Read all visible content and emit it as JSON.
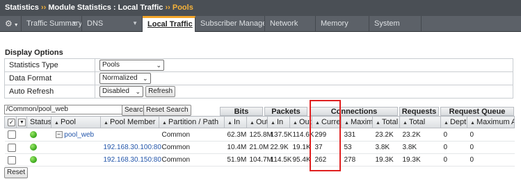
{
  "breadcrumb": {
    "items": [
      "Statistics",
      "Module Statistics : Local Traffic",
      "Pools"
    ],
    "separator": "››"
  },
  "tabs": [
    {
      "label": "Traffic Summary",
      "has_dropdown": true,
      "active": false
    },
    {
      "label": "DNS",
      "has_dropdown": true,
      "active": false
    },
    {
      "label": "Local Traffic",
      "has_dropdown": false,
      "active": true
    },
    {
      "label": "Subscriber Management",
      "has_dropdown": false,
      "active": false
    },
    {
      "label": "Network",
      "has_dropdown": false,
      "active": false
    },
    {
      "label": "Memory",
      "has_dropdown": false,
      "active": false
    },
    {
      "label": "System",
      "has_dropdown": false,
      "active": false
    }
  ],
  "gear_icon": "gear-icon",
  "display_options": {
    "title": "Display Options",
    "statistics_type": {
      "label": "Statistics Type",
      "value": "Pools"
    },
    "data_format": {
      "label": "Data Format",
      "value": "Normalized"
    },
    "auto_refresh": {
      "label": "Auto Refresh",
      "value": "Disabled",
      "refresh_button": "Refresh"
    }
  },
  "search": {
    "value": "/Common/pool_web",
    "search_button": "Search",
    "reset_search_button": "Reset Search"
  },
  "column_groups": {
    "bits": "Bits",
    "packets": "Packets",
    "connections": "Connections",
    "requests": "Requests",
    "request_queue": "Request Queue"
  },
  "columns": {
    "status": "Status",
    "pool": "Pool",
    "pool_member": "Pool Member",
    "partition": "Partition / Path",
    "bits_in": "In",
    "bits_out": "Out",
    "packets_in": "In",
    "packets_out": "Out",
    "current": "Current",
    "maximum": "Maximum",
    "total": "Total",
    "requests_total": "Total",
    "depth": "Depth",
    "maximum_age": "Maximum Age"
  },
  "rows": [
    {
      "pool": "pool_web",
      "pool_member": "",
      "partition": "Common",
      "bits_in": "62.3M",
      "bits_out": "125.8M",
      "packets_in": "137.5K",
      "packets_out": "114.6K",
      "current": "299",
      "maximum": "331",
      "total": "23.2K",
      "requests_total": "23.2K",
      "depth": "0",
      "maximum_age": "0"
    },
    {
      "pool": "",
      "pool_member": "192.168.30.100:80",
      "partition": "Common",
      "bits_in": "10.4M",
      "bits_out": "21.0M",
      "packets_in": "22.9K",
      "packets_out": "19.1K",
      "current": "37",
      "maximum": "53",
      "total": "3.8K",
      "requests_total": "3.8K",
      "depth": "0",
      "maximum_age": "0"
    },
    {
      "pool": "",
      "pool_member": "192.168.30.150:80",
      "partition": "Common",
      "bits_in": "51.9M",
      "bits_out": "104.7M",
      "packets_in": "114.5K",
      "packets_out": "95.4K",
      "current": "262",
      "maximum": "278",
      "total": "19.3K",
      "requests_total": "19.3K",
      "depth": "0",
      "maximum_age": "0"
    }
  ],
  "reset_button": "Reset",
  "colors": {
    "header_bg": "#4a4f55",
    "accent": "#f5b23a",
    "status_green": "#37a618",
    "link_blue": "#2255aa",
    "highlight_red": "#e02020"
  }
}
